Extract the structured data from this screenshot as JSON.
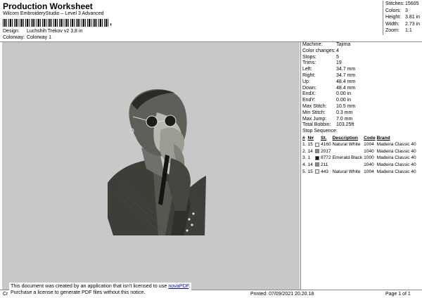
{
  "header": {
    "title": "Production Worksheet",
    "subtitle": "Wilcom EmbroideryStudio – Level 3 Advanced"
  },
  "meta": {
    "design_label": "Design:",
    "design_value": "Luchshih Trekov v2 3,8 in",
    "colorway_label": "Colorway:",
    "colorway_value": "Colorway 1"
  },
  "top_stats": [
    {
      "k": "Stitches:",
      "v": "15605"
    },
    {
      "k": "Colors:",
      "v": "3"
    },
    {
      "k": "Height:",
      "v": "3.81 in"
    },
    {
      "k": "Width:",
      "v": "2.73 in"
    },
    {
      "k": "Zoom:",
      "v": "1:1"
    }
  ],
  "machine_info": [
    {
      "k": "Machine:",
      "v": "Tajima"
    },
    {
      "k": "Color changes:",
      "v": "4"
    },
    {
      "k": "Stops:",
      "v": "5"
    },
    {
      "k": "Trims:",
      "v": "19"
    },
    {
      "k": "Left:",
      "v": "34.7 mm"
    },
    {
      "k": "Right:",
      "v": "34.7 mm"
    },
    {
      "k": "Up:",
      "v": "48.4 mm"
    },
    {
      "k": "Down:",
      "v": "48.4 mm"
    },
    {
      "k": "EndX:",
      "v": "0.00 in"
    },
    {
      "k": "EndY:",
      "v": "0.00 in"
    },
    {
      "k": "Max Stitch:",
      "v": "10.5 mm"
    },
    {
      "k": "Min Stitch:",
      "v": "0.3 mm"
    },
    {
      "k": "Max Jump:",
      "v": "7.0 mm"
    },
    {
      "k": "Total Bobbin:",
      "v": "103.25ft"
    }
  ],
  "stop_sequence": {
    "title": "Stop Sequence:",
    "headers": [
      "#",
      "N#",
      "St.",
      "Description",
      "Code",
      "Brand"
    ],
    "rows": [
      {
        "idx": "1.",
        "n": "15",
        "color": "#e6e6e2",
        "st": "4160",
        "desc": "Natural White",
        "code": "1004",
        "brand": "Madeira Classic 40"
      },
      {
        "idx": "2.",
        "n": "14",
        "color": "#8a8a8a",
        "st": "2017",
        "desc": "",
        "code": "1040",
        "brand": "Madeira Classic 40"
      },
      {
        "idx": "3.",
        "n": "1",
        "color": "#111111",
        "st": "8772",
        "desc": "Emerald Black",
        "code": "1000",
        "brand": "Madeira Classic 40"
      },
      {
        "idx": "4.",
        "n": "14",
        "color": "#8a8a8a",
        "st": "211",
        "desc": "",
        "code": "1040",
        "brand": "Madeira Classic 40"
      },
      {
        "idx": "5.",
        "n": "15",
        "color": "#e6e6e2",
        "st": "443",
        "desc": "Natural White",
        "code": "1004",
        "brand": "Madeira Classic 40"
      }
    ]
  },
  "notice": {
    "line1": "This document was created by an application that isn't licensed to use ",
    "link": "novaPDF",
    "line1_end": ".",
    "line2": "Purchase a license to generate PDF files without this notice."
  },
  "footer": {
    "left": "Cr",
    "printed": "Printed: 07/09/2021 20.20.18",
    "page": "Page 1 of 1"
  },
  "colors": {
    "background_panel": "#c8c8c8",
    "rule": "#888888"
  }
}
